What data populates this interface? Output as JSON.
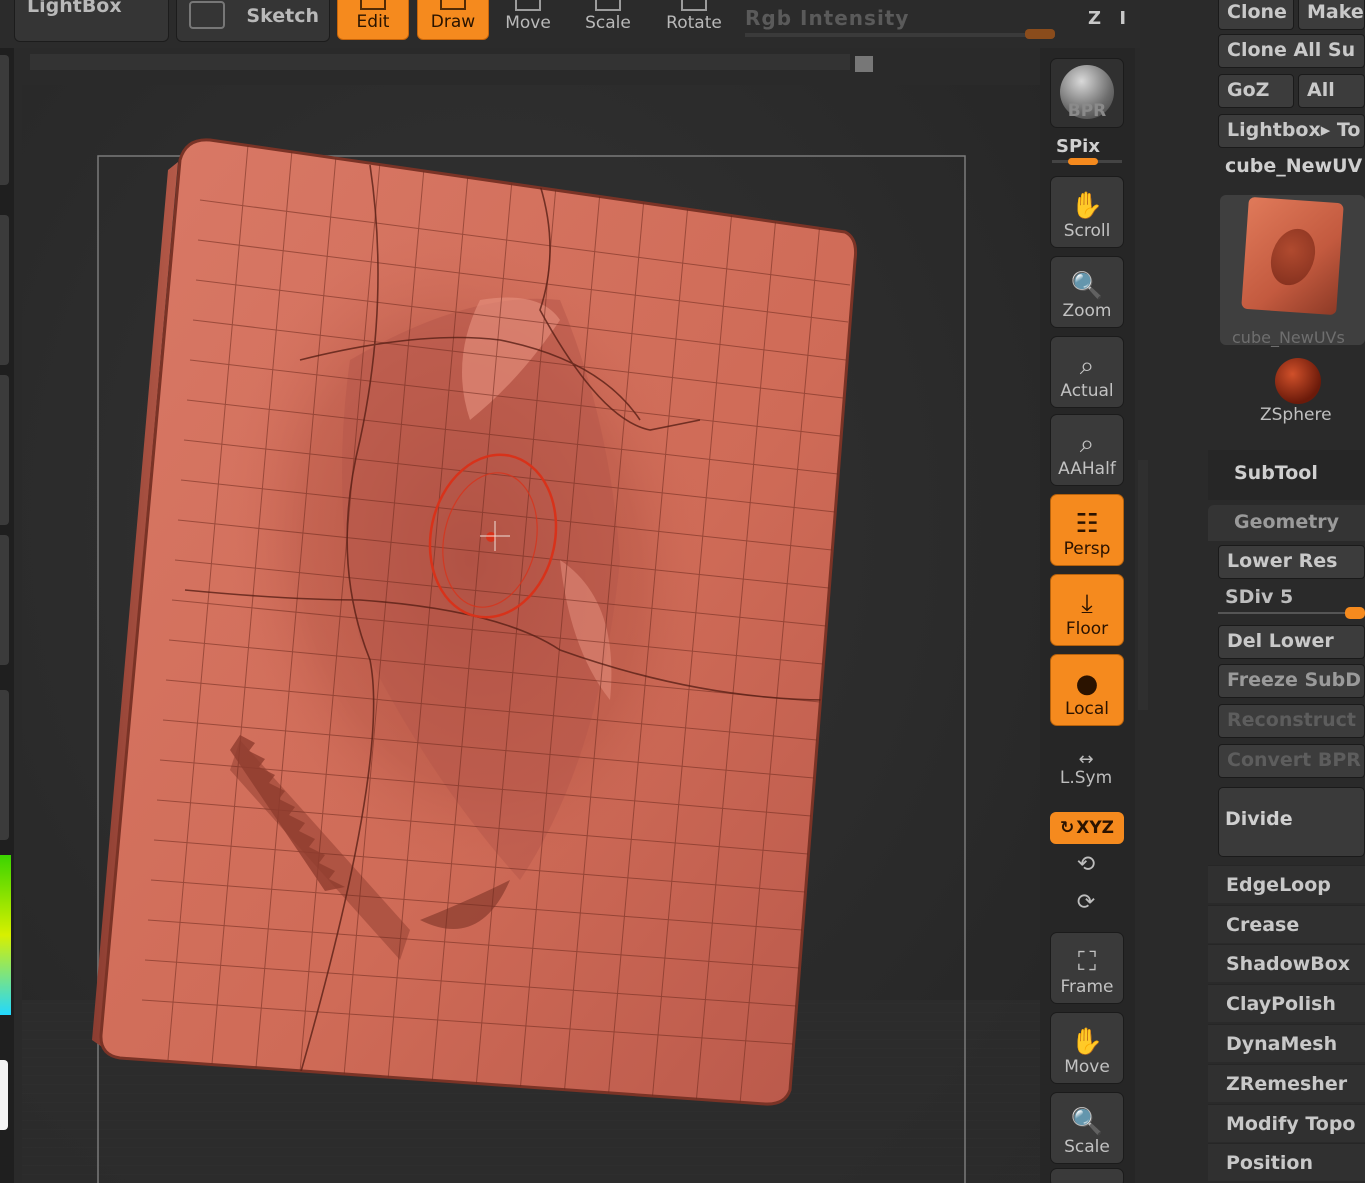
{
  "toolbar": {
    "lightbox_label": "LightBox",
    "sketch_label": "Sketch",
    "tools": [
      {
        "label": "Edit",
        "active": true
      },
      {
        "label": "Draw",
        "active": true
      },
      {
        "label": "Move",
        "active": false
      },
      {
        "label": "Scale",
        "active": false
      },
      {
        "label": "Rotate",
        "active": false
      }
    ],
    "rgb_intensity_label": "Rgb Intensity",
    "zi_label": "Z I"
  },
  "shelf": {
    "bpr": "BPR",
    "spix": "SPix",
    "scroll": "Scroll",
    "zoom": "Zoom",
    "actual": "Actual",
    "aahalf": "AAHalf",
    "persp": "Persp",
    "floor": "Floor",
    "local": "Local",
    "lsym": "L.Sym",
    "xyz": "XYZ",
    "frame": "Frame",
    "move": "Move",
    "scale": "Scale"
  },
  "tool_panel": {
    "clone": "Clone",
    "make": "Make",
    "clone_all": "Clone All Su",
    "goz": "GoZ",
    "all": "All",
    "lightbox_tools": "Lightbox▸ To",
    "tool_name": "cube_NewUV",
    "thumb_caption": "cube_NewUVs",
    "zsphere": "ZSphere",
    "subtool": "SubTool"
  },
  "geometry": {
    "header": "Geometry",
    "lower_res": "Lower Res",
    "sdiv": "SDiv 5",
    "del_lower": "Del Lower",
    "freeze": "Freeze SubD",
    "reconstruct": "Reconstruct",
    "convert": "Convert BPR",
    "divide": "Divide",
    "items": [
      "EdgeLoop",
      "Crease",
      "ShadowBox",
      "ClayPolish",
      "DynaMesh",
      "ZRemesher",
      "Modify Topo",
      "Position"
    ]
  },
  "colors": {
    "accent": "#f58a1e",
    "mesh": "#d36f5c",
    "brush_ring": "#d8321a"
  }
}
